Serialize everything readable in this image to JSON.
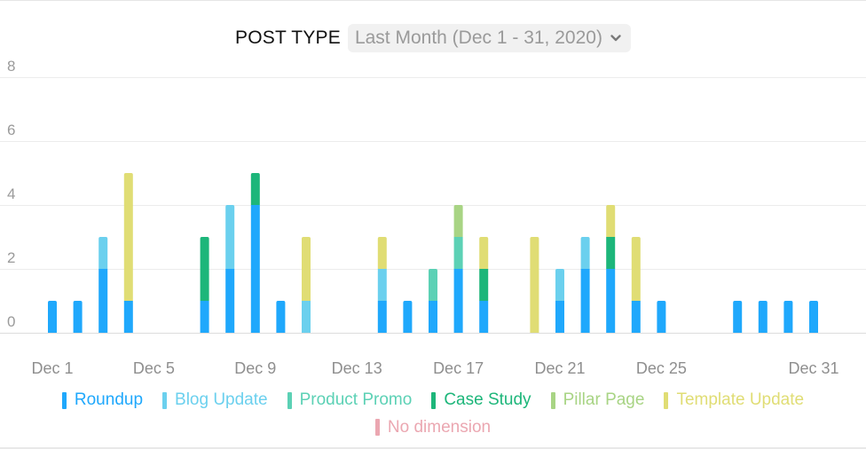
{
  "header": {
    "title": "POST TYPE",
    "date_range": "Last Month (Dec 1 - 31, 2020)",
    "dropdown_icon": "chevron-down-icon"
  },
  "chart_data": {
    "type": "bar",
    "stacked": true,
    "title": "POST TYPE",
    "xlabel": "",
    "ylabel": "",
    "ylim": [
      0,
      8
    ],
    "yticks": [
      "0",
      "2",
      "4",
      "6",
      "8"
    ],
    "grid": true,
    "legend_position": "bottom",
    "categories": [
      "Dec 1",
      "Dec 2",
      "Dec 3",
      "Dec 4",
      "Dec 5",
      "Dec 6",
      "Dec 7",
      "Dec 8",
      "Dec 9",
      "Dec 10",
      "Dec 11",
      "Dec 12",
      "Dec 13",
      "Dec 14",
      "Dec 15",
      "Dec 16",
      "Dec 17",
      "Dec 18",
      "Dec 19",
      "Dec 20",
      "Dec 21",
      "Dec 22",
      "Dec 23",
      "Dec 24",
      "Dec 25",
      "Dec 26",
      "Dec 27",
      "Dec 28",
      "Dec 29",
      "Dec 30",
      "Dec 31"
    ],
    "xtick_labels": [
      {
        "index": 0,
        "label": "Dec 1"
      },
      {
        "index": 4,
        "label": "Dec 5"
      },
      {
        "index": 8,
        "label": "Dec 9"
      },
      {
        "index": 12,
        "label": "Dec 13"
      },
      {
        "index": 16,
        "label": "Dec 17"
      },
      {
        "index": 20,
        "label": "Dec 21"
      },
      {
        "index": 24,
        "label": "Dec 25"
      },
      {
        "index": 30,
        "label": "Dec 31"
      }
    ],
    "series": [
      {
        "name": "Roundup",
        "color": "#1fa8fc",
        "values": [
          1,
          1,
          2,
          1,
          0,
          0,
          1,
          2,
          4,
          1,
          0,
          0,
          0,
          1,
          1,
          1,
          2,
          1,
          0,
          0,
          1,
          2,
          2,
          1,
          1,
          0,
          0,
          1,
          1,
          1,
          1
        ]
      },
      {
        "name": "Blog Update",
        "color": "#6bd0ee",
        "values": [
          0,
          0,
          1,
          0,
          0,
          0,
          0,
          2,
          0,
          0,
          1,
          0,
          0,
          1,
          0,
          0,
          0,
          0,
          0,
          0,
          1,
          1,
          0,
          0,
          0,
          0,
          0,
          0,
          0,
          0,
          0
        ]
      },
      {
        "name": "Product Promo",
        "color": "#5cd1b5",
        "values": [
          0,
          0,
          0,
          0,
          0,
          0,
          0,
          0,
          0,
          0,
          0,
          0,
          0,
          0,
          0,
          1,
          1,
          0,
          0,
          0,
          0,
          0,
          0,
          0,
          0,
          0,
          0,
          0,
          0,
          0,
          0
        ]
      },
      {
        "name": "Case Study",
        "color": "#1db67a",
        "values": [
          0,
          0,
          0,
          0,
          0,
          0,
          2,
          0,
          1,
          0,
          0,
          0,
          0,
          0,
          0,
          0,
          0,
          1,
          0,
          0,
          0,
          0,
          1,
          0,
          0,
          0,
          0,
          0,
          0,
          0,
          0
        ]
      },
      {
        "name": "Pillar Page",
        "color": "#a8d484",
        "values": [
          0,
          0,
          0,
          0,
          0,
          0,
          0,
          0,
          0,
          0,
          0,
          0,
          0,
          0,
          0,
          0,
          1,
          0,
          0,
          0,
          0,
          0,
          0,
          0,
          0,
          0,
          0,
          0,
          0,
          0,
          0
        ]
      },
      {
        "name": "Template Update",
        "color": "#e0dd74",
        "values": [
          0,
          0,
          0,
          4,
          0,
          0,
          0,
          0,
          0,
          0,
          2,
          0,
          0,
          1,
          0,
          0,
          0,
          1,
          0,
          3,
          0,
          0,
          1,
          2,
          0,
          0,
          0,
          0,
          0,
          0,
          0
        ]
      },
      {
        "name": "No dimension",
        "color": "#eba7b1",
        "values": [
          0,
          0,
          0,
          0,
          0,
          0,
          0,
          0,
          0,
          0,
          0,
          0,
          0,
          0,
          0,
          0,
          0,
          0,
          0,
          0,
          0,
          0,
          0,
          0,
          0,
          0,
          0,
          0,
          0,
          0,
          0
        ]
      }
    ]
  },
  "legend": [
    {
      "label": "Roundup",
      "color": "#1fa8fc"
    },
    {
      "label": "Blog Update",
      "color": "#6bd0ee"
    },
    {
      "label": "Product Promo",
      "color": "#5cd1b5"
    },
    {
      "label": "Case Study",
      "color": "#1db67a"
    },
    {
      "label": "Pillar Page",
      "color": "#a8d484"
    },
    {
      "label": "Template Update",
      "color": "#e0dd74"
    },
    {
      "label": "No dimension",
      "color": "#eba7b1"
    }
  ]
}
